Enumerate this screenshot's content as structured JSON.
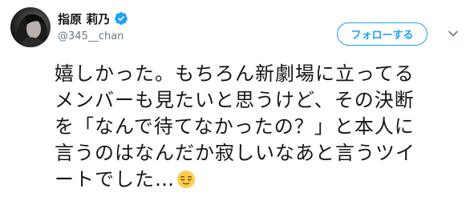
{
  "user": {
    "display_name": "指原 莉乃",
    "handle": "@345__chan",
    "verified": true
  },
  "follow_button": {
    "label": "フォローする"
  },
  "tweet": {
    "text": "嬉しかった。もちろん新劇場に立ってる\nメンバーも見たいと思うけど、その決断\nを「なんで待てなかったの？」と本人に\n言うのはなんだか寂しいなあと言うツイ\nートでした…",
    "emoji": "relieved-face-emoji"
  },
  "colors": {
    "accent": "#1da1f2",
    "text": "#14171a",
    "secondary": "#657786",
    "caret": "#657786"
  },
  "icons": {
    "verified": "verified-badge-icon",
    "menu": "chevron-down-icon"
  }
}
